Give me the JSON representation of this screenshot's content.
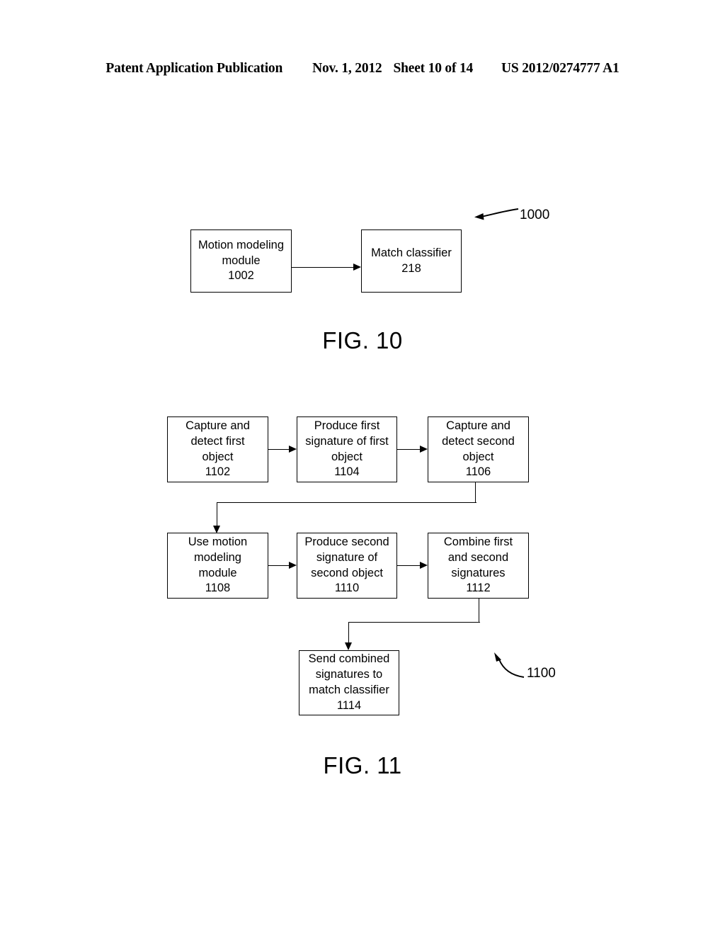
{
  "header": {
    "publication": "Patent Application Publication",
    "date": "Nov. 1, 2012",
    "sheet": "Sheet 10 of 14",
    "patent_number": "US 2012/0274777 A1"
  },
  "figures": [
    {
      "caption": "FIG. 10",
      "reference_number": "1000",
      "boxes": [
        {
          "id": "1002",
          "lines": [
            "Motion modeling",
            "module",
            "1002"
          ]
        },
        {
          "id": "218",
          "lines": [
            "Match classifier",
            "218"
          ]
        }
      ]
    },
    {
      "caption": "FIG. 11",
      "reference_number": "1100",
      "boxes": [
        {
          "id": "1102",
          "lines": [
            "Capture and",
            "detect first",
            "object",
            "1102"
          ]
        },
        {
          "id": "1104",
          "lines": [
            "Produce first",
            "signature of first",
            "object",
            "1104"
          ]
        },
        {
          "id": "1106",
          "lines": [
            "Capture and",
            "detect second",
            "object",
            "1106"
          ]
        },
        {
          "id": "1108",
          "lines": [
            "Use motion",
            "modeling",
            "module",
            "1108"
          ]
        },
        {
          "id": "1110",
          "lines": [
            "Produce second",
            "signature of",
            "second object",
            "1110"
          ]
        },
        {
          "id": "1112",
          "lines": [
            "Combine first",
            "and second",
            "signatures",
            "1112"
          ]
        },
        {
          "id": "1114",
          "lines": [
            "Send combined",
            "signatures to",
            "match classifier",
            "1114"
          ]
        }
      ]
    }
  ],
  "colors": {
    "ink": "#000000",
    "paper": "#ffffff"
  }
}
